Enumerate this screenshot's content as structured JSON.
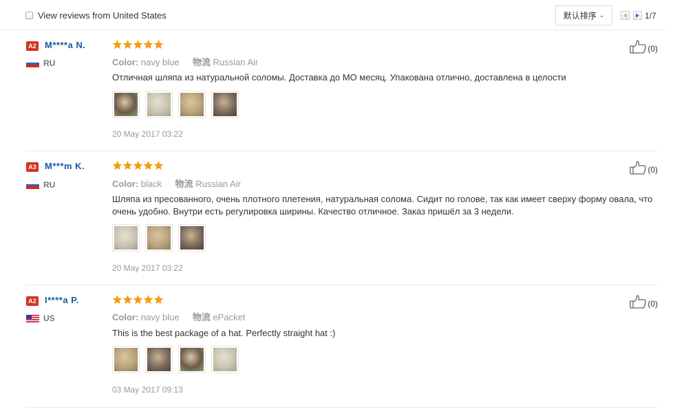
{
  "toolbar": {
    "filter_label": "View reviews from United States",
    "sort_label": "默认排序",
    "page": "1/7"
  },
  "reviews": [
    {
      "level": "A2",
      "name": "M****a N.",
      "country": "RU",
      "flag": "ru",
      "rating": 5,
      "color_label": "Color:",
      "color_value": "navy blue",
      "shipping_label": "物流",
      "shipping_value": "Russian Air",
      "text": "Отличная шляпа из натуральной соломы. Доставка до МО месяц. Упакована отлично, доставлена в целости",
      "date": "20 May 2017 03:22",
      "likes": "(0)",
      "photos": [
        "hat-photo-1",
        "hat-photo-2",
        "hat-photo-3",
        "hat-photo-4"
      ]
    },
    {
      "level": "A3",
      "name": "M***m K.",
      "country": "RU",
      "flag": "ru",
      "rating": 5,
      "color_label": "Color:",
      "color_value": "black",
      "shipping_label": "物流",
      "shipping_value": "Russian Air",
      "text": "Шляпа из пресованного, очень плотного плетения, натуральная солома. Сидит по голове, так как имеет сверху форму овала, что очень удобно. Внутри есть регулировка ширины. Качество отличное. Заказ пришёл за 3 недели.",
      "date": "20 May 2017 03:22",
      "likes": "(0)",
      "photos": [
        "hat-photo-1",
        "hat-photo-2",
        "hat-photo-3"
      ]
    },
    {
      "level": "A2",
      "name": "I****a P.",
      "country": "US",
      "flag": "us",
      "rating": 5,
      "color_label": "Color:",
      "color_value": "navy blue",
      "shipping_label": "物流",
      "shipping_value": "ePacket",
      "text": "This is the best package of a hat. Perfectly straight hat :)",
      "date": "03 May 2017 09:13",
      "likes": "(0)",
      "photos": [
        "hat-photo-1",
        "hat-photo-2",
        "hat-photo-3",
        "hat-photo-4"
      ]
    }
  ],
  "colors": {
    "username": "#1a57a6",
    "level_badge": "#d6331f",
    "star": "#f39c12",
    "muted": "#999999"
  }
}
